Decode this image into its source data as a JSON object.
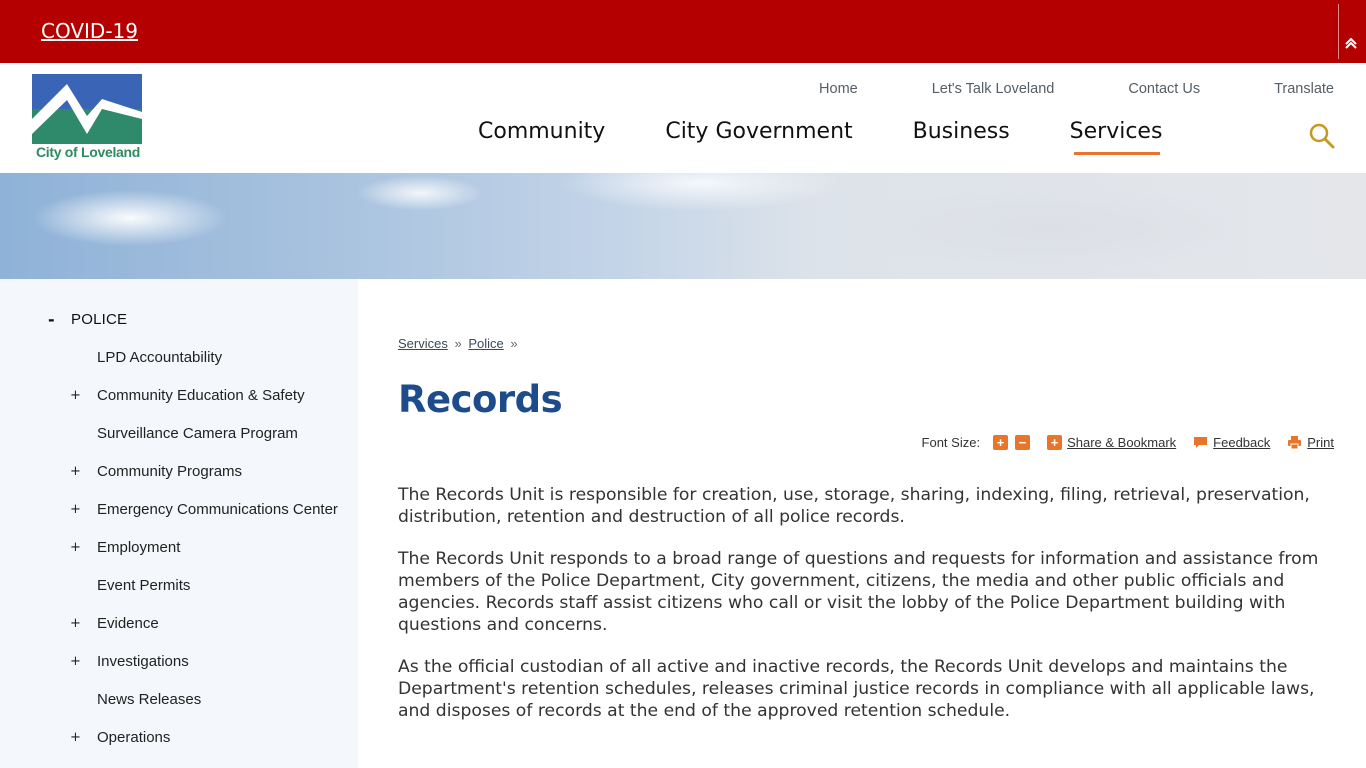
{
  "alert": {
    "label": "COVID-19"
  },
  "logo": {
    "text": "City of Loveland"
  },
  "utility_nav": [
    "Home",
    "Let's Talk Loveland",
    "Contact Us",
    "Translate"
  ],
  "main_nav": [
    "Community",
    "City Government",
    "Business",
    "Services"
  ],
  "main_nav_active": "Services",
  "colors": {
    "alert_bg": "#b40000",
    "accent": "#e8752a",
    "title": "#1c4c8c"
  },
  "sidebar": {
    "heading": "POLICE",
    "heading_toggle": "-",
    "items": [
      {
        "label": "LPD Accountability",
        "toggle": ""
      },
      {
        "label": "Community Education & Safety",
        "toggle": "+"
      },
      {
        "label": "Surveillance Camera Program",
        "toggle": ""
      },
      {
        "label": "Community Programs",
        "toggle": "+"
      },
      {
        "label": "Emergency Communications Center",
        "toggle": "+"
      },
      {
        "label": "Employment",
        "toggle": "+"
      },
      {
        "label": "Event Permits",
        "toggle": ""
      },
      {
        "label": "Evidence",
        "toggle": "+"
      },
      {
        "label": "Investigations",
        "toggle": "+"
      },
      {
        "label": "News Releases",
        "toggle": ""
      },
      {
        "label": "Operations",
        "toggle": "+"
      }
    ]
  },
  "breadcrumb": {
    "items": [
      "Services",
      "Police"
    ],
    "sep": "»"
  },
  "page_title": "Records",
  "tools": {
    "font_size_label": "Font Size:",
    "increase": "+",
    "decrease": "−",
    "share": "Share & Bookmark",
    "feedback": "Feedback",
    "print": "Print"
  },
  "content": {
    "paragraphs": [
      "The Records Unit is responsible for creation, use, storage, sharing, indexing, filing, retrieval, preservation, distribution, retention and destruction of all police records.",
      "The Records Unit responds to a broad range of questions and requests for information and assistance from members of the Police Department, City government, citizens, the media and other public officials and agencies. Records staff assist citizens who call or visit the lobby of the Police Department building with questions and concerns.",
      "As the official custodian of all active and inactive records, the Records Unit develops and maintains the Department's retention schedules, releases criminal justice records in compliance with all applicable laws, and disposes of records at the end of the approved retention schedule."
    ]
  }
}
